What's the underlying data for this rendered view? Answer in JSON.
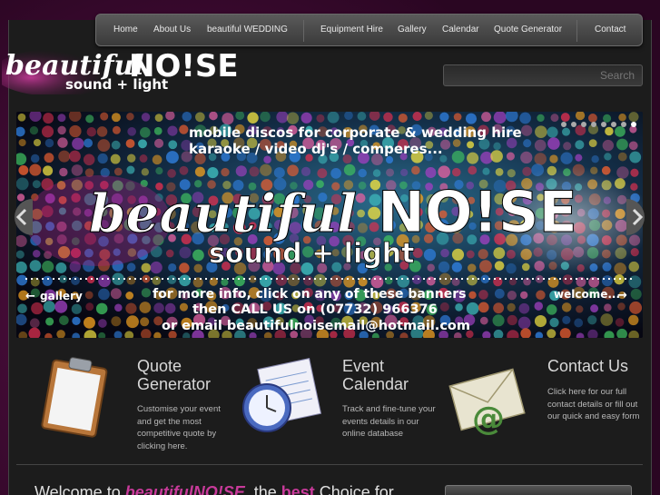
{
  "nav": {
    "items": [
      "Home",
      "About Us",
      "beautiful WEDDING",
      "Equipment Hire",
      "Gallery",
      "Calendar",
      "Quote Generator",
      "Contact"
    ]
  },
  "logo": {
    "word_script": "beautiful",
    "word_block": "NO!SE",
    "tagline": "sound + light"
  },
  "search": {
    "placeholder": "Search"
  },
  "banner": {
    "top_line1": "mobile discos for corporate & wedding hire",
    "top_line2": "karaoke / video dj's / comperes...",
    "logo_script": "beautiful",
    "logo_block": "NO!SE",
    "logo_tagline": "sound + light",
    "left_link": "gallery",
    "right_link": "welcome...",
    "info_line1": "for more info, click on any of these banners",
    "info_line2": "then CALL US on (07732) 966376",
    "info_line3": "or email beautifulnoisemail@hotmail.com",
    "dots_count": 8,
    "active_dot": 7
  },
  "features": [
    {
      "title": "Quote Generator",
      "text": "Customise your event and get the most competitive quote by clicking here.",
      "icon": "clipboard-icon"
    },
    {
      "title": "Event Calendar",
      "text": "Track and fine-tune your events details in our online database",
      "icon": "clock-calendar-icon"
    },
    {
      "title": "Contact Us",
      "text": "Click here for our full contact details or fill out our quick and easy form",
      "icon": "envelope-icon"
    }
  ],
  "welcome": {
    "prefix": "Welcome to ",
    "brand": "beautifulNO!SE",
    "middle": ", the ",
    "highlight": "best",
    "suffix": " Choice for"
  },
  "colors": {
    "accent": "#c83a9a",
    "background": "#1c1c1c",
    "outer": "#3a0a2e"
  }
}
